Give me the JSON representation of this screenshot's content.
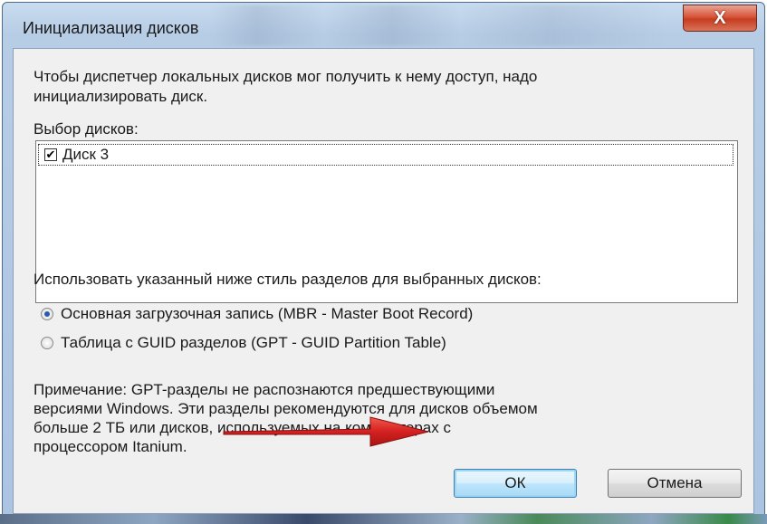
{
  "dialog": {
    "title": "Инициализация дисков",
    "close_label": "X",
    "intro_line1": "Чтобы диспетчер локальных дисков мог получить к нему доступ, надо",
    "intro_line2": "инициализировать диск.",
    "disk_select_label": "Выбор дисков:",
    "disks": [
      {
        "label": "Диск 3",
        "checked": true
      }
    ],
    "partition_style_label": "Использовать указанный ниже стиль разделов для выбранных дисков:",
    "partition_options": [
      {
        "label": "Основная загрузочная запись (MBR - Master Boot Record)",
        "selected": true
      },
      {
        "label": "Таблица с GUID разделов (GPT - GUID Partition Table)",
        "selected": false
      }
    ],
    "note_line1": "Примечание: GPT-разделы не распознаются предшествующими",
    "note_line2": "версиями Windows. Эти разделы рекомендуются для дисков объемом",
    "note_line3": "больше 2 ТБ или дисков, используемых на компьютерах с",
    "note_line4": "процессором Itanium.",
    "ok_label": "ОК",
    "cancel_label": "Отмена"
  },
  "colors": {
    "arrow": "#d42020",
    "close_button": "#c63d20",
    "default_button_border": "#3c7fb1"
  }
}
